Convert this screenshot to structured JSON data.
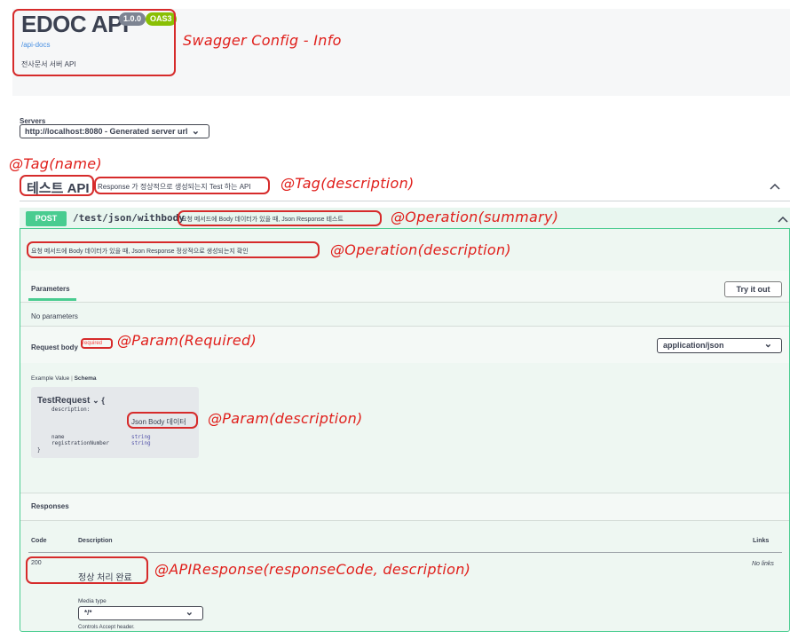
{
  "info": {
    "title": "EDOC API",
    "version": "1.0.0",
    "oas": "OAS3",
    "docs_link": "/api-docs",
    "description": "전사문서 서버 API"
  },
  "servers": {
    "label": "Servers",
    "selected": "http://localhost:8080 - Generated server url"
  },
  "tag": {
    "name": "테스트 API",
    "description": "Response 가 정상적으로 생성되는지 Test 하는 API",
    "collapse_icon": "chevron-up-icon"
  },
  "operation": {
    "method": "POST",
    "path": "/test/json/withbody",
    "summary": "요청 메서드에 Body 데이터가 있을 때, Json Response 테스트",
    "description": "요청 메서드에 Body 데이터가 있을 때, Json Response 정상적으로 생성되는지 확인",
    "collapse_icon": "chevron-up-icon"
  },
  "parameters": {
    "tab_label": "Parameters",
    "try_button": "Try it out",
    "empty_text": "No parameters"
  },
  "request_body": {
    "label": "Request body",
    "required": "required",
    "content_type": "application/json",
    "example_tab": "Example Value",
    "schema_tab": "Schema",
    "model": {
      "name": "TestRequest",
      "open_brace": "{",
      "close_brace": "}",
      "desc_key": "description:",
      "desc_value": "Json Body 데이터",
      "fields": [
        {
          "name": "name",
          "type": "string"
        },
        {
          "name": "registrationNumber",
          "type": "string"
        }
      ]
    }
  },
  "responses": {
    "title": "Responses",
    "col_code": "Code",
    "col_description": "Description",
    "col_links": "Links",
    "rows": [
      {
        "code": "200",
        "description": "정상 처리 완료",
        "links": "No links"
      }
    ],
    "media_type_label": "Media type",
    "media_type_value": "*/*",
    "controls_text": "Controls Accept header."
  },
  "annotations": {
    "info": "Swagger Config - Info",
    "tag_name": "@Tag(name)",
    "tag_description": "@Tag(description)",
    "op_summary": "@Operation(summary)",
    "op_description": "@Operation(description)",
    "param_required": "@Param(Required)",
    "param_description": "@Param(description)",
    "api_response": "@APIResponse(responseCode, description)"
  },
  "colors": {
    "post_green": "#49cc90",
    "annotation_red": "#e0201c",
    "badge_version": "#7d8492",
    "badge_oas": "#89bf04"
  }
}
